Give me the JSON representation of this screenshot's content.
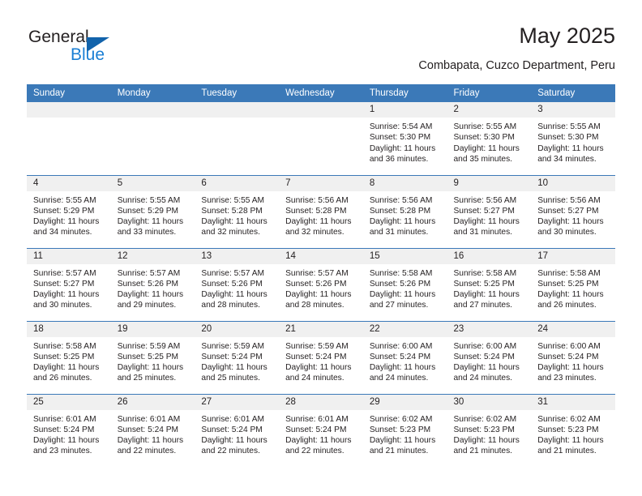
{
  "brand": {
    "name_part1": "General",
    "name_part2": "Blue",
    "flag_icon": "blue-triangle-logo-icon",
    "accent_color": "#1b7fd4"
  },
  "header": {
    "month_title": "May 2025",
    "location": "Combapata, Cuzco Department, Peru"
  },
  "theme": {
    "header_blue": "#3b79b8",
    "daynum_gray": "#f0f0f0",
    "text_color": "#231f20"
  },
  "calendar": {
    "weekday_headers": [
      "Sunday",
      "Monday",
      "Tuesday",
      "Wednesday",
      "Thursday",
      "Friday",
      "Saturday"
    ],
    "weeks": [
      [
        {
          "day": "",
          "sunrise": "",
          "sunset": "",
          "daylight_line1": "",
          "daylight_line2": ""
        },
        {
          "day": "",
          "sunrise": "",
          "sunset": "",
          "daylight_line1": "",
          "daylight_line2": ""
        },
        {
          "day": "",
          "sunrise": "",
          "sunset": "",
          "daylight_line1": "",
          "daylight_line2": ""
        },
        {
          "day": "",
          "sunrise": "",
          "sunset": "",
          "daylight_line1": "",
          "daylight_line2": ""
        },
        {
          "day": "1",
          "sunrise": "Sunrise: 5:54 AM",
          "sunset": "Sunset: 5:30 PM",
          "daylight_line1": "Daylight: 11 hours",
          "daylight_line2": "and 36 minutes."
        },
        {
          "day": "2",
          "sunrise": "Sunrise: 5:55 AM",
          "sunset": "Sunset: 5:30 PM",
          "daylight_line1": "Daylight: 11 hours",
          "daylight_line2": "and 35 minutes."
        },
        {
          "day": "3",
          "sunrise": "Sunrise: 5:55 AM",
          "sunset": "Sunset: 5:30 PM",
          "daylight_line1": "Daylight: 11 hours",
          "daylight_line2": "and 34 minutes."
        }
      ],
      [
        {
          "day": "4",
          "sunrise": "Sunrise: 5:55 AM",
          "sunset": "Sunset: 5:29 PM",
          "daylight_line1": "Daylight: 11 hours",
          "daylight_line2": "and 34 minutes."
        },
        {
          "day": "5",
          "sunrise": "Sunrise: 5:55 AM",
          "sunset": "Sunset: 5:29 PM",
          "daylight_line1": "Daylight: 11 hours",
          "daylight_line2": "and 33 minutes."
        },
        {
          "day": "6",
          "sunrise": "Sunrise: 5:55 AM",
          "sunset": "Sunset: 5:28 PM",
          "daylight_line1": "Daylight: 11 hours",
          "daylight_line2": "and 32 minutes."
        },
        {
          "day": "7",
          "sunrise": "Sunrise: 5:56 AM",
          "sunset": "Sunset: 5:28 PM",
          "daylight_line1": "Daylight: 11 hours",
          "daylight_line2": "and 32 minutes."
        },
        {
          "day": "8",
          "sunrise": "Sunrise: 5:56 AM",
          "sunset": "Sunset: 5:28 PM",
          "daylight_line1": "Daylight: 11 hours",
          "daylight_line2": "and 31 minutes."
        },
        {
          "day": "9",
          "sunrise": "Sunrise: 5:56 AM",
          "sunset": "Sunset: 5:27 PM",
          "daylight_line1": "Daylight: 11 hours",
          "daylight_line2": "and 31 minutes."
        },
        {
          "day": "10",
          "sunrise": "Sunrise: 5:56 AM",
          "sunset": "Sunset: 5:27 PM",
          "daylight_line1": "Daylight: 11 hours",
          "daylight_line2": "and 30 minutes."
        }
      ],
      [
        {
          "day": "11",
          "sunrise": "Sunrise: 5:57 AM",
          "sunset": "Sunset: 5:27 PM",
          "daylight_line1": "Daylight: 11 hours",
          "daylight_line2": "and 30 minutes."
        },
        {
          "day": "12",
          "sunrise": "Sunrise: 5:57 AM",
          "sunset": "Sunset: 5:26 PM",
          "daylight_line1": "Daylight: 11 hours",
          "daylight_line2": "and 29 minutes."
        },
        {
          "day": "13",
          "sunrise": "Sunrise: 5:57 AM",
          "sunset": "Sunset: 5:26 PM",
          "daylight_line1": "Daylight: 11 hours",
          "daylight_line2": "and 28 minutes."
        },
        {
          "day": "14",
          "sunrise": "Sunrise: 5:57 AM",
          "sunset": "Sunset: 5:26 PM",
          "daylight_line1": "Daylight: 11 hours",
          "daylight_line2": "and 28 minutes."
        },
        {
          "day": "15",
          "sunrise": "Sunrise: 5:58 AM",
          "sunset": "Sunset: 5:26 PM",
          "daylight_line1": "Daylight: 11 hours",
          "daylight_line2": "and 27 minutes."
        },
        {
          "day": "16",
          "sunrise": "Sunrise: 5:58 AM",
          "sunset": "Sunset: 5:25 PM",
          "daylight_line1": "Daylight: 11 hours",
          "daylight_line2": "and 27 minutes."
        },
        {
          "day": "17",
          "sunrise": "Sunrise: 5:58 AM",
          "sunset": "Sunset: 5:25 PM",
          "daylight_line1": "Daylight: 11 hours",
          "daylight_line2": "and 26 minutes."
        }
      ],
      [
        {
          "day": "18",
          "sunrise": "Sunrise: 5:58 AM",
          "sunset": "Sunset: 5:25 PM",
          "daylight_line1": "Daylight: 11 hours",
          "daylight_line2": "and 26 minutes."
        },
        {
          "day": "19",
          "sunrise": "Sunrise: 5:59 AM",
          "sunset": "Sunset: 5:25 PM",
          "daylight_line1": "Daylight: 11 hours",
          "daylight_line2": "and 25 minutes."
        },
        {
          "day": "20",
          "sunrise": "Sunrise: 5:59 AM",
          "sunset": "Sunset: 5:24 PM",
          "daylight_line1": "Daylight: 11 hours",
          "daylight_line2": "and 25 minutes."
        },
        {
          "day": "21",
          "sunrise": "Sunrise: 5:59 AM",
          "sunset": "Sunset: 5:24 PM",
          "daylight_line1": "Daylight: 11 hours",
          "daylight_line2": "and 24 minutes."
        },
        {
          "day": "22",
          "sunrise": "Sunrise: 6:00 AM",
          "sunset": "Sunset: 5:24 PM",
          "daylight_line1": "Daylight: 11 hours",
          "daylight_line2": "and 24 minutes."
        },
        {
          "day": "23",
          "sunrise": "Sunrise: 6:00 AM",
          "sunset": "Sunset: 5:24 PM",
          "daylight_line1": "Daylight: 11 hours",
          "daylight_line2": "and 24 minutes."
        },
        {
          "day": "24",
          "sunrise": "Sunrise: 6:00 AM",
          "sunset": "Sunset: 5:24 PM",
          "daylight_line1": "Daylight: 11 hours",
          "daylight_line2": "and 23 minutes."
        }
      ],
      [
        {
          "day": "25",
          "sunrise": "Sunrise: 6:01 AM",
          "sunset": "Sunset: 5:24 PM",
          "daylight_line1": "Daylight: 11 hours",
          "daylight_line2": "and 23 minutes."
        },
        {
          "day": "26",
          "sunrise": "Sunrise: 6:01 AM",
          "sunset": "Sunset: 5:24 PM",
          "daylight_line1": "Daylight: 11 hours",
          "daylight_line2": "and 22 minutes."
        },
        {
          "day": "27",
          "sunrise": "Sunrise: 6:01 AM",
          "sunset": "Sunset: 5:24 PM",
          "daylight_line1": "Daylight: 11 hours",
          "daylight_line2": "and 22 minutes."
        },
        {
          "day": "28",
          "sunrise": "Sunrise: 6:01 AM",
          "sunset": "Sunset: 5:24 PM",
          "daylight_line1": "Daylight: 11 hours",
          "daylight_line2": "and 22 minutes."
        },
        {
          "day": "29",
          "sunrise": "Sunrise: 6:02 AM",
          "sunset": "Sunset: 5:23 PM",
          "daylight_line1": "Daylight: 11 hours",
          "daylight_line2": "and 21 minutes."
        },
        {
          "day": "30",
          "sunrise": "Sunrise: 6:02 AM",
          "sunset": "Sunset: 5:23 PM",
          "daylight_line1": "Daylight: 11 hours",
          "daylight_line2": "and 21 minutes."
        },
        {
          "day": "31",
          "sunrise": "Sunrise: 6:02 AM",
          "sunset": "Sunset: 5:23 PM",
          "daylight_line1": "Daylight: 11 hours",
          "daylight_line2": "and 21 minutes."
        }
      ]
    ]
  }
}
